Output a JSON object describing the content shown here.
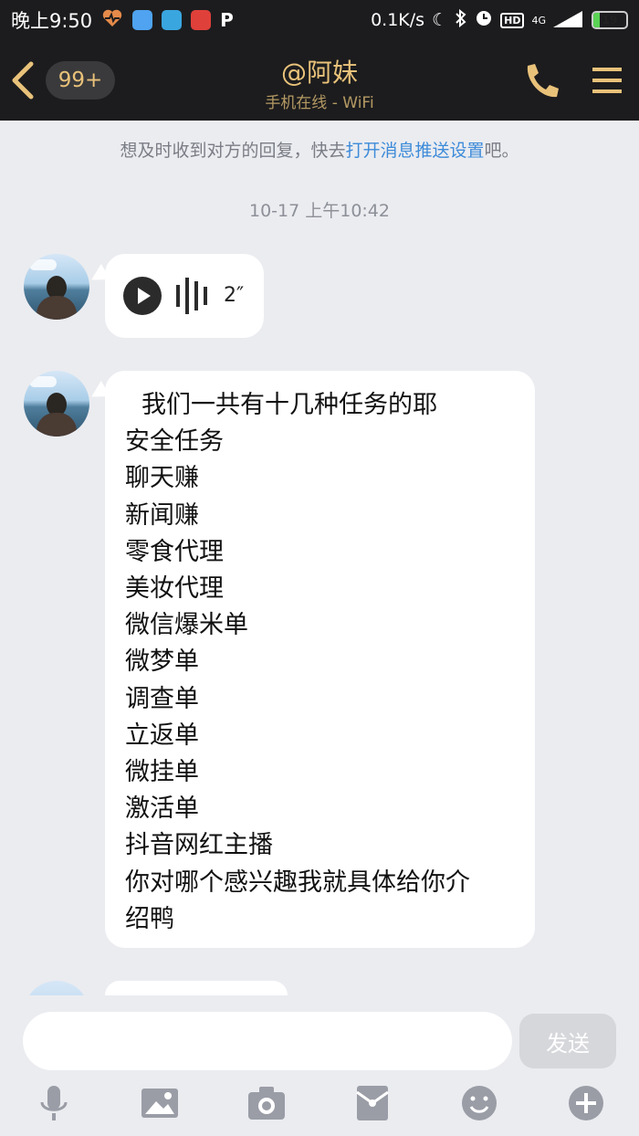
{
  "status_bar": {
    "time": "晚上9:50",
    "network_speed": "0.1K/s",
    "network_type": "4G",
    "battery": "19",
    "battery_level": 0.19
  },
  "header": {
    "back_badge": "99+",
    "title": "@阿妹",
    "subtitle": "手机在线 - WiFi"
  },
  "notice": {
    "prefix": "想及时收到对方的回复，快去",
    "link": "打开消息推送设置",
    "suffix": "吧。"
  },
  "timestamp": "10-17 上午10:42",
  "messages": {
    "voice": {
      "duration": "2″"
    },
    "text": {
      "lines": [
        "我们一共有十几种任务的耶",
        "安全任务",
        "聊天赚",
        "新闻赚",
        "零食代理",
        "美妆代理",
        "微信爆米单",
        "微梦单",
        "调查单",
        "立返单",
        "微挂单",
        "激活单",
        "抖音网红主播",
        "你对哪个感兴趣我就具体给你介",
        "绍鸭"
      ]
    }
  },
  "composer": {
    "send_label": "发送"
  },
  "colors": {
    "accent": "#e9c27a",
    "header_bg": "#1c1c1e",
    "chat_bg": "#ebecf0",
    "link": "#3d8bd9"
  }
}
